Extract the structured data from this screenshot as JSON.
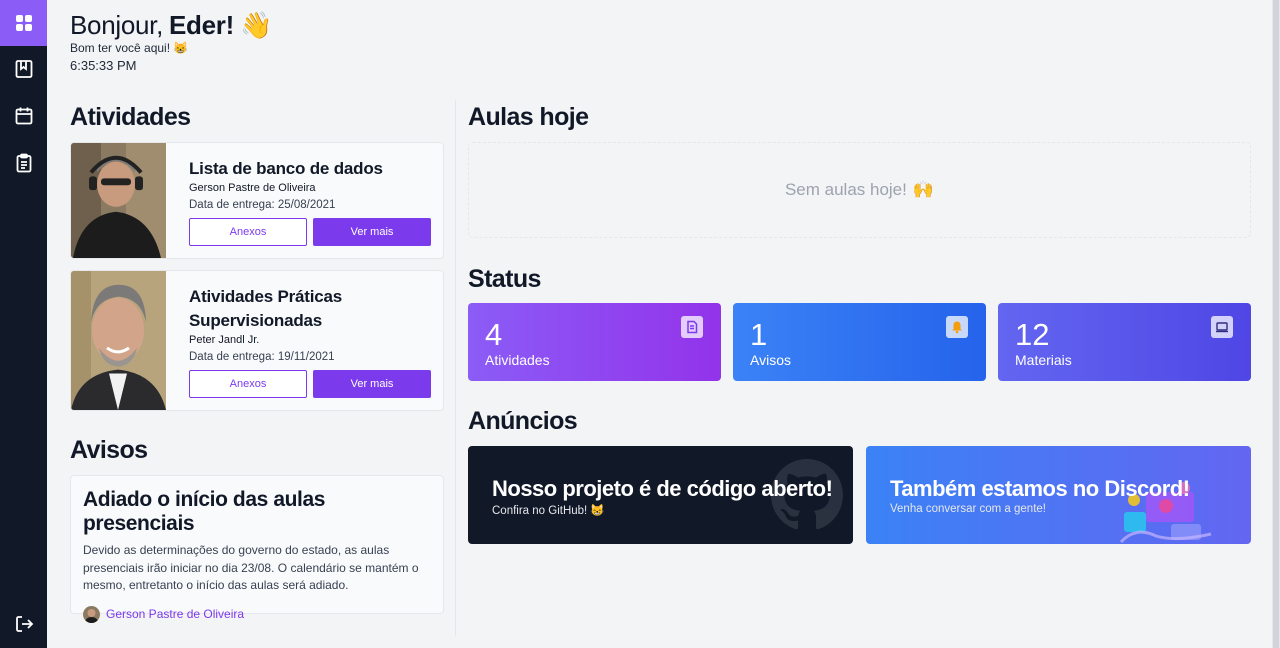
{
  "sidebar": {
    "items": [
      {
        "icon": "grid-icon",
        "active": true
      },
      {
        "icon": "book-icon",
        "active": false
      },
      {
        "icon": "calendar-icon",
        "active": false
      },
      {
        "icon": "clipboard-icon",
        "active": false
      }
    ],
    "logout_icon": "logout-icon"
  },
  "greeting": {
    "hello": "Bonjour,",
    "name": "Eder!",
    "emoji": "👋",
    "subtitle": "Bom ter você aqui! 😸",
    "time": "6:35:33 PM"
  },
  "activities": {
    "title": "Atividades",
    "items": [
      {
        "title": "Lista de banco de dados",
        "author": "Gerson Pastre de Oliveira",
        "due": "Data de entrega: 25/08/2021",
        "attachments_label": "Anexos",
        "more_label": "Ver mais"
      },
      {
        "title": "Atividades Práticas Supervisionadas",
        "author": "Peter Jandl Jr.",
        "due": "Data de entrega: 19/11/2021",
        "attachments_label": "Anexos",
        "more_label": "Ver mais"
      }
    ]
  },
  "notices": {
    "title": "Avisos",
    "item": {
      "title": "Adiado o início das aulas presenciais",
      "text": "Devido as determinações do governo do estado, as aulas presenciais irão iniciar no dia 23/08. O calendário se mantém o mesmo, entretanto o início das aulas será adiado.",
      "author": "Gerson Pastre de Oliveira"
    }
  },
  "classes_today": {
    "title": "Aulas hoje",
    "empty_text": "Sem aulas hoje!",
    "empty_emoji": "🙌"
  },
  "status": {
    "title": "Status",
    "cards": [
      {
        "value": "4",
        "label": "Atividades",
        "icon": "document-icon",
        "color": "#8b5cf6"
      },
      {
        "value": "1",
        "label": "Avisos",
        "icon": "bell-icon",
        "color": "#3b82f6"
      },
      {
        "value": "12",
        "label": "Materiais",
        "icon": "laptop-icon",
        "color": "#6366f1"
      }
    ]
  },
  "announcements": {
    "title": "Anúncios",
    "cards": [
      {
        "title": "Nosso projeto é de código aberto!",
        "subtitle": "Confira no GitHub! 😸",
        "icon": "github-icon"
      },
      {
        "title": "Também estamos no Discord!",
        "subtitle": "Venha conversar com a gente!",
        "icon": "discord-illustration"
      }
    ]
  },
  "colors": {
    "sidebar": "#111827",
    "accent": "#7c3aed",
    "dark_card": "#111827"
  }
}
